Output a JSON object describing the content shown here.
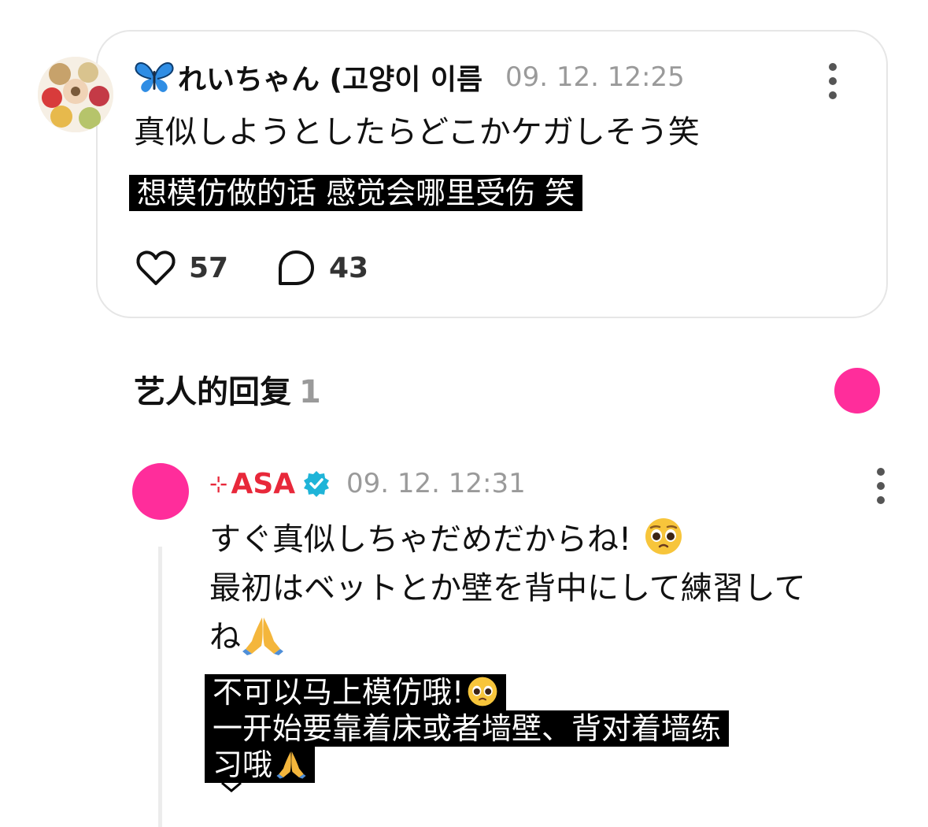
{
  "post": {
    "author_name": "れいちゃん (고양이 이름",
    "author_icon": "butterfly-emoji",
    "timestamp": "09. 12. 12:25",
    "text": "真似しようとしたらどこかケガしそう笑",
    "translation": "想模仿做的话 感觉会哪里受伤 笑",
    "likes": "57",
    "replies": "43"
  },
  "section": {
    "title": "艺人的回复",
    "count": "1",
    "accent_color": "#ff2d9b"
  },
  "reply": {
    "author_prefix": "⊹",
    "author_name": "ASA",
    "verified": true,
    "timestamp": "09. 12. 12:31",
    "lines": [
      "すぐ真似しちゃだめだからね!",
      "最初はベットとか壁を背中にして練習して",
      "ね"
    ],
    "translation_lines": [
      "不可以马上模仿哦!",
      "一开始要靠着床或者墙壁、背对着墙练",
      "习哦"
    ],
    "emojis": [
      "pleading-face-emoji",
      "folded-hands-emoji"
    ],
    "author_color": "#e8283a"
  }
}
